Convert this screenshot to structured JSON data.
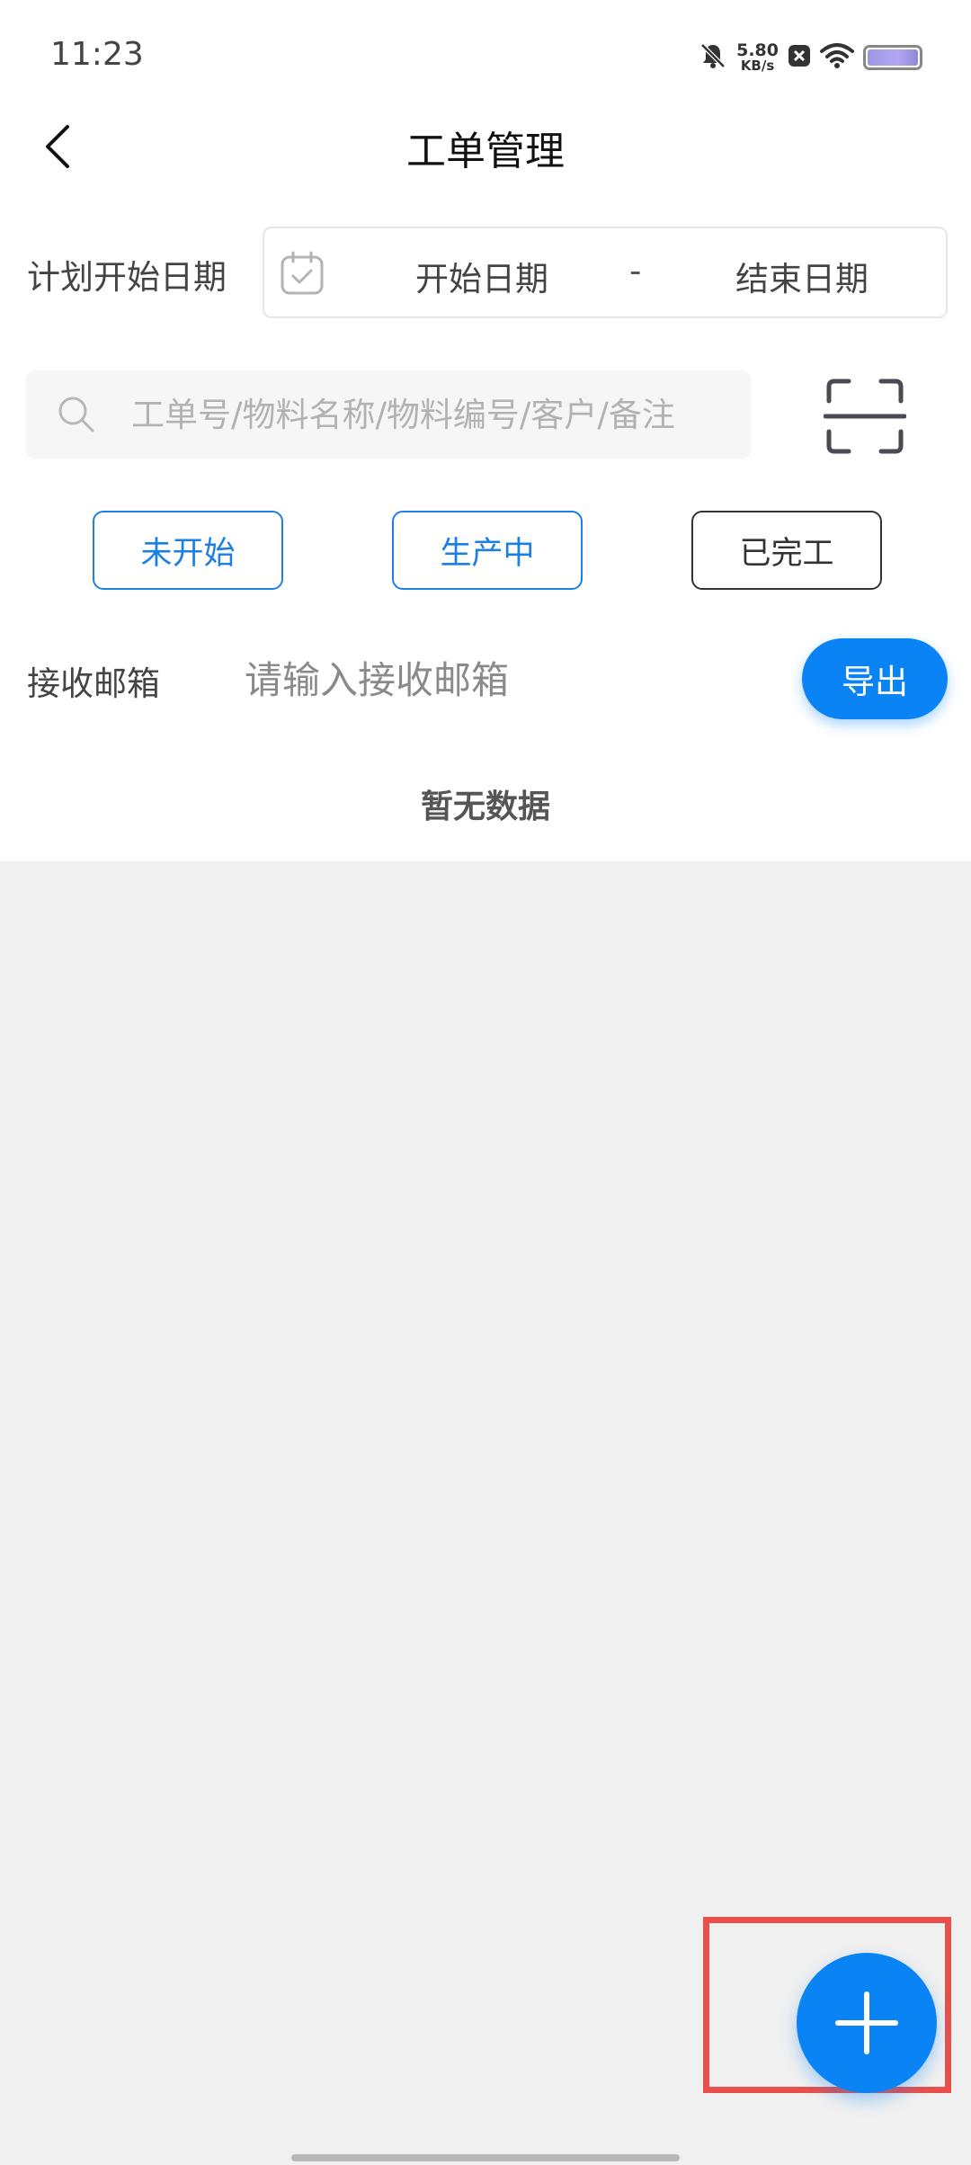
{
  "status_bar": {
    "time": "11:23",
    "net_speed_value": "5.80",
    "net_speed_unit": "KB/s",
    "icons": [
      "bell-muted-icon",
      "app-notification-icon",
      "wifi-icon",
      "battery-icon"
    ]
  },
  "header": {
    "title": "工单管理",
    "back_icon": "chevron-left-icon"
  },
  "date_filter": {
    "label": "计划开始日期",
    "start_placeholder": "开始日期",
    "separator": "-",
    "end_placeholder": "结束日期",
    "icon": "calendar-check-icon"
  },
  "search": {
    "placeholder": "工单号/物料名称/物料编号/客户/备注",
    "icon": "search-icon",
    "scan_icon": "scan-icon"
  },
  "status_filters": [
    {
      "label": "未开始",
      "style": "blue"
    },
    {
      "label": "生产中",
      "style": "blue"
    },
    {
      "label": "已完工",
      "style": "dark"
    }
  ],
  "email": {
    "label": "接收邮箱",
    "placeholder": "请输入接收邮箱"
  },
  "export_button": "导出",
  "empty_text": "暂无数据",
  "fab_icon": "plus-icon",
  "colors": {
    "accent": "#0a84f5",
    "filter_blue": "#1b7fe3",
    "highlight": "#e8504c",
    "background": "#f0f0f0"
  }
}
